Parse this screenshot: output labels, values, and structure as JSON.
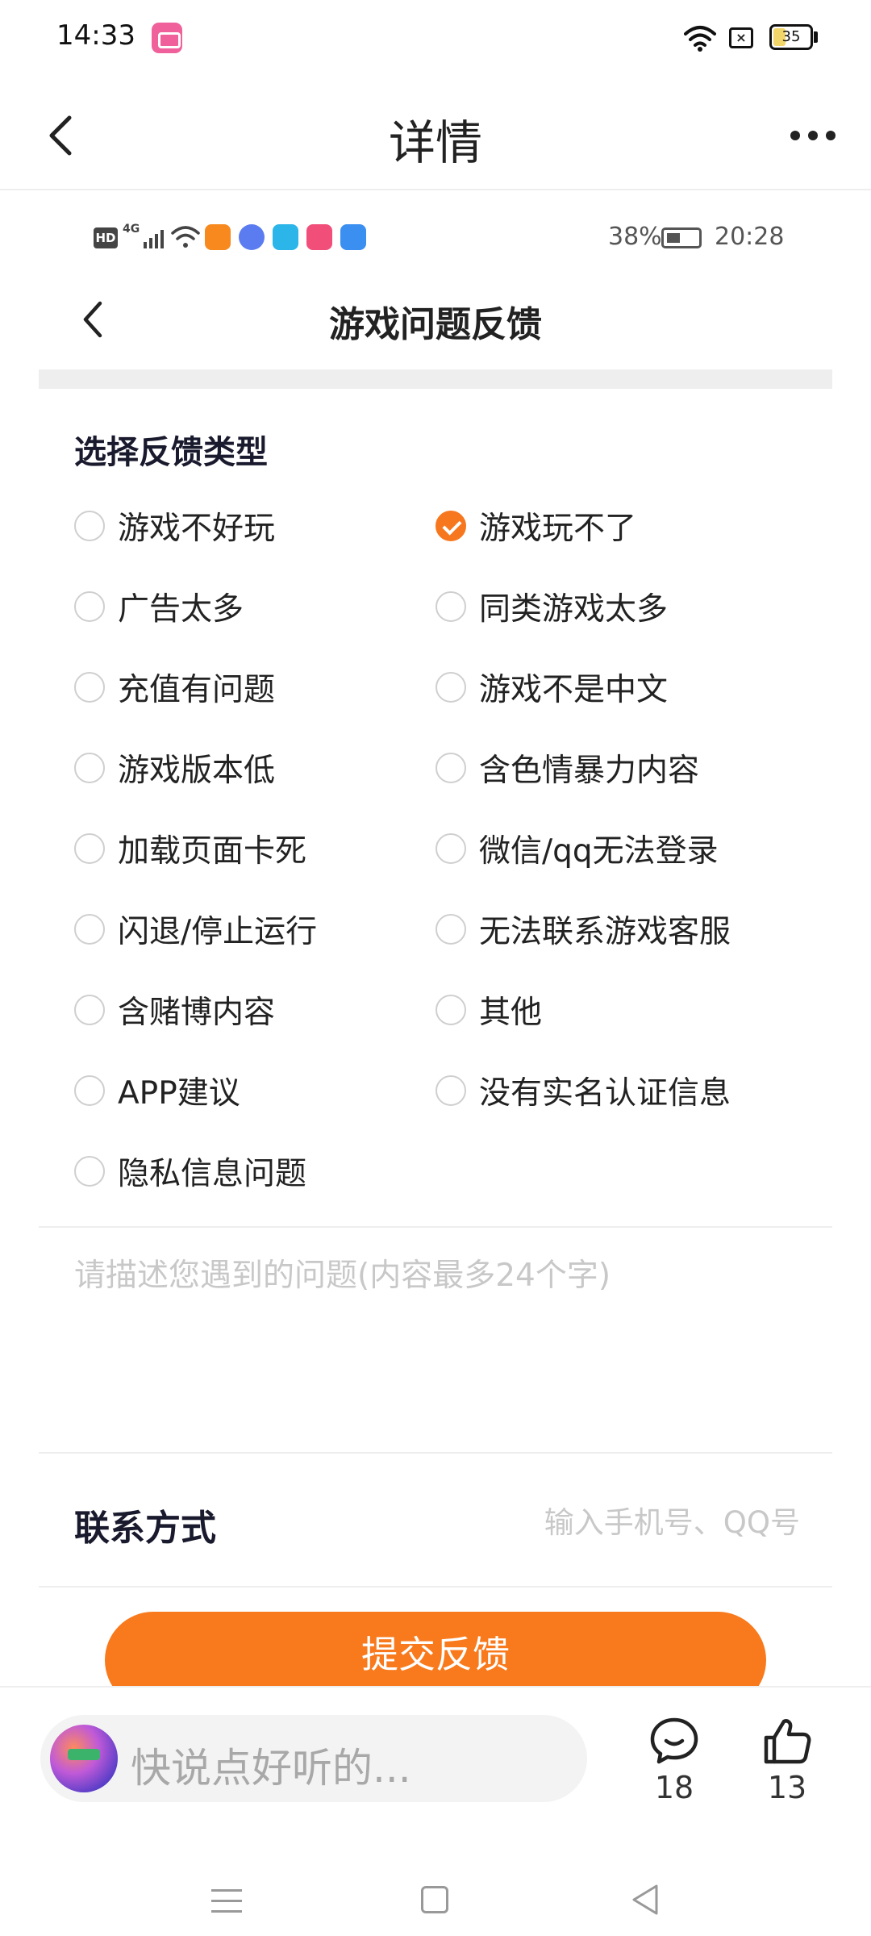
{
  "status_bar": {
    "time": "14:33",
    "battery": "35",
    "battery_level": 0.35
  },
  "nav": {
    "title": "详情"
  },
  "inner_status": {
    "hd": "HD",
    "network": "4G",
    "battery": "38%",
    "time": "20:28"
  },
  "form": {
    "title": "游戏问题反馈",
    "section_title": "选择反馈类型",
    "options": [
      {
        "label": "游戏不好玩",
        "checked": false
      },
      {
        "label": "游戏玩不了",
        "checked": true
      },
      {
        "label": "广告太多",
        "checked": false
      },
      {
        "label": "同类游戏太多",
        "checked": false
      },
      {
        "label": "充值有问题",
        "checked": false
      },
      {
        "label": "游戏不是中文",
        "checked": false
      },
      {
        "label": "游戏版本低",
        "checked": false
      },
      {
        "label": "含色情暴力内容",
        "checked": false
      },
      {
        "label": "加载页面卡死",
        "checked": false
      },
      {
        "label": "微信/qq无法登录",
        "checked": false
      },
      {
        "label": "闪退/停止运行",
        "checked": false
      },
      {
        "label": "无法联系游戏客服",
        "checked": false
      },
      {
        "label": "含赌博内容",
        "checked": false
      },
      {
        "label": "其他",
        "checked": false
      },
      {
        "label": "APP建议",
        "checked": false
      },
      {
        "label": "没有实名认证信息",
        "checked": false
      },
      {
        "label": "隐私信息问题",
        "checked": false
      }
    ],
    "description_placeholder": "请描述您遇到的问题(内容最多24个字)",
    "description_value": "",
    "contact_label": "联系方式",
    "contact_placeholder": "输入手机号、QQ号",
    "contact_value": "",
    "submit_label": "提交反馈"
  },
  "bottom_bar": {
    "comment_placeholder": "快说点好听的...",
    "comment_count": "18",
    "like_count": "13"
  },
  "colors": {
    "accent": "#f87a1c",
    "divider": "#eeeeee"
  }
}
